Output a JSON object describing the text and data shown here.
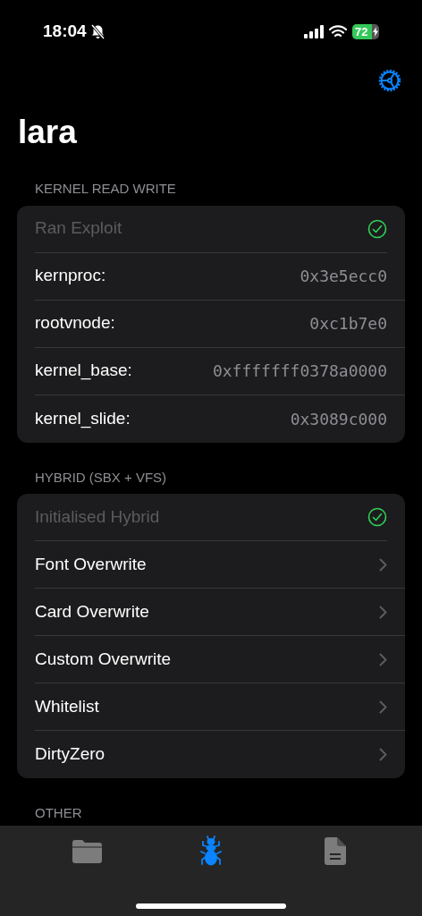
{
  "status_bar": {
    "time": "18:04",
    "silent": true,
    "battery": "72",
    "charging": true
  },
  "title": "lara",
  "sections": [
    {
      "header": "KERNEL READ WRITE",
      "rows": [
        {
          "kind": "status",
          "label": "Ran Exploit",
          "checked": true
        },
        {
          "kind": "value",
          "label": "kernproc:",
          "value": "0x3e5ecc0"
        },
        {
          "kind": "value",
          "label": "rootvnode:",
          "value": "0xc1b7e0"
        },
        {
          "kind": "value",
          "label": "kernel_base:",
          "value": "0xfffffff0378a0000"
        },
        {
          "kind": "value",
          "label": "kernel_slide:",
          "value": "0x3089c000"
        }
      ]
    },
    {
      "header": "HYBRID (SBX + VFS)",
      "rows": [
        {
          "kind": "status",
          "label": "Initialised Hybrid",
          "checked": true
        },
        {
          "kind": "link",
          "label": "Font Overwrite"
        },
        {
          "kind": "link",
          "label": "Card Overwrite"
        },
        {
          "kind": "link",
          "label": "Custom Overwrite"
        },
        {
          "kind": "link",
          "label": "Whitelist"
        },
        {
          "kind": "link",
          "label": "DirtyZero"
        }
      ]
    },
    {
      "header": "OTHER"
    }
  ],
  "tabs": [
    {
      "kind": "folder",
      "selected": false
    },
    {
      "kind": "bug",
      "selected": true
    },
    {
      "kind": "document",
      "selected": false
    }
  ]
}
